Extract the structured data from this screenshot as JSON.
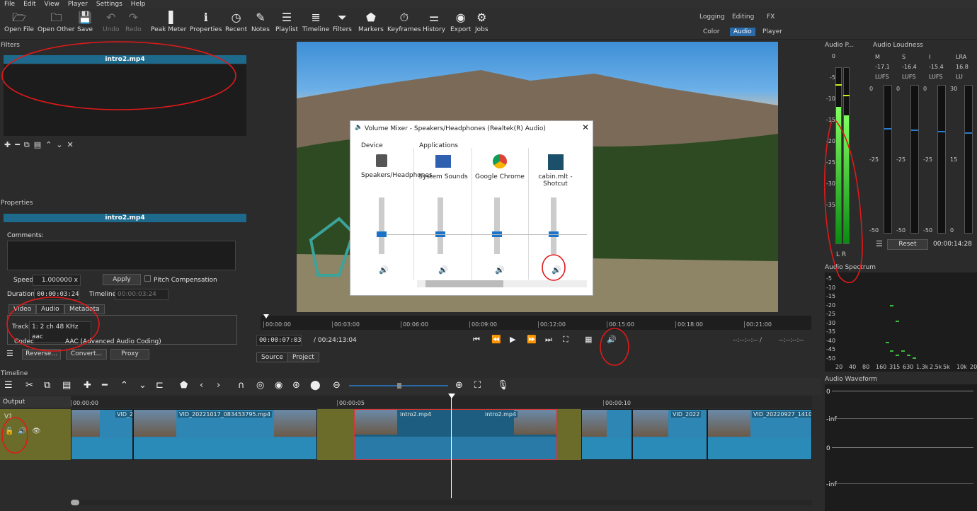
{
  "menu": [
    "File",
    "Edit",
    "View",
    "Player",
    "Settings",
    "Help"
  ],
  "toolbar": [
    {
      "label": "Open File",
      "icon": "folder-open-icon",
      "glyph": "🗁"
    },
    {
      "label": "Open Other",
      "icon": "open-other-icon",
      "glyph": "🗀"
    },
    {
      "label": "Save",
      "icon": "save-icon",
      "glyph": "💾"
    },
    {
      "label": "Undo",
      "icon": "undo-icon",
      "glyph": "↶"
    },
    {
      "label": "Redo",
      "icon": "redo-icon",
      "glyph": "↷"
    },
    {
      "label": "Peak Meter",
      "icon": "peak-meter-icon",
      "glyph": "▐"
    },
    {
      "label": "Properties",
      "icon": "info-icon",
      "glyph": "ℹ"
    },
    {
      "label": "Recent",
      "icon": "clock-icon",
      "glyph": "◷"
    },
    {
      "label": "Notes",
      "icon": "notes-icon",
      "glyph": "✎"
    },
    {
      "label": "Playlist",
      "icon": "playlist-icon",
      "glyph": "☰"
    },
    {
      "label": "Timeline",
      "icon": "timeline-icon",
      "glyph": "≣"
    },
    {
      "label": "Filters",
      "icon": "filter-icon",
      "glyph": "⏷"
    },
    {
      "label": "Markers",
      "icon": "marker-icon",
      "glyph": "⬟"
    },
    {
      "label": "Keyframes",
      "icon": "stopwatch-icon",
      "glyph": "⏱"
    },
    {
      "label": "History",
      "icon": "history-icon",
      "glyph": "⚌"
    },
    {
      "label": "Export",
      "icon": "export-icon",
      "glyph": "◉"
    },
    {
      "label": "Jobs",
      "icon": "gear-icon",
      "glyph": "⚙"
    }
  ],
  "layouts": {
    "logging": "Logging",
    "editing": "Editing",
    "fx": "FX",
    "color": "Color",
    "audio": "Audio",
    "player": "Player"
  },
  "filters": {
    "title": "Filters",
    "clip": "intro2.mp4"
  },
  "properties": {
    "title": "Properties",
    "clip": "intro2.mp4",
    "comments_label": "Comments:",
    "speed_label": "Speed",
    "speed_value": "1.000000 x",
    "apply": "Apply",
    "pitch": "Pitch Compensation",
    "duration_label": "Duration",
    "duration_value": "00:00:03:24",
    "timeline_label": "Timeline",
    "timeline_value": "00:00:03:24",
    "tabs": [
      "Video",
      "Audio",
      "Metadata"
    ],
    "track_label": "Track",
    "track_value": "1: 2 ch 48 KHz aac",
    "codec_label": "Codec",
    "codec_value": "AAC (Advanced Audio Coding)",
    "reverse": "Reverse...",
    "convert": "Convert...",
    "proxy": "Proxy"
  },
  "player": {
    "ruler": [
      "00:00:00",
      "00:03:00",
      "00:06:00",
      "00:09:00",
      "00:12:00",
      "00:15:00",
      "00:18:00",
      "00:21:00"
    ],
    "position": "00:00:07:03",
    "duration": "/ 00:24:13:04",
    "in": "--:--:--:-- /",
    "out": "--:--:--:--",
    "source": "Source",
    "project": "Project"
  },
  "mixer": {
    "title": "Volume Mixer - Speakers/Headphones (Realtek(R) Audio)",
    "device": "Device",
    "applications": "Applications",
    "items": [
      "Speakers/Headphones",
      "System Sounds",
      "Google Chrome",
      "cabin.mlt - Shotcut"
    ]
  },
  "audio_peak": {
    "title": "Audio P...",
    "scale": [
      "0",
      "-5",
      "-10",
      "-15",
      "-20",
      "-25",
      "-30",
      "-35"
    ],
    "lr": "L  R",
    "L": 0.78,
    "R": 0.73
  },
  "loudness": {
    "title": "Audio Loudness",
    "cols": [
      "M",
      "S",
      "I",
      "LRA"
    ],
    "vals": [
      "-17.1",
      "-16.4",
      "-15.4",
      "16.8"
    ],
    "units": [
      "LUFS",
      "LUFS",
      "LUFS",
      "LU"
    ],
    "top": [
      "0",
      "0",
      "0",
      "30"
    ],
    "mid": [
      "-25",
      "-25",
      "-25",
      "15"
    ],
    "bot": [
      "-50",
      "-50",
      "-50",
      "0"
    ],
    "reset": "Reset",
    "time": "00:00:14:28"
  },
  "spectrum": {
    "title": "Audio Spectrum",
    "scale": [
      "-5",
      "-10",
      "-15",
      "-20",
      "-25",
      "-30",
      "-35",
      "-40",
      "-45",
      "-50"
    ],
    "freqs": [
      "20",
      "40",
      "80",
      "160",
      "315",
      "630",
      "1.3k",
      "2.5k",
      "5k",
      "10k",
      "20k"
    ]
  },
  "waveform": {
    "title": "Audio Waveform",
    "labels": [
      "0",
      "-inf",
      "0",
      "-inf"
    ]
  },
  "timeline": {
    "title": "Timeline",
    "output": "Output",
    "track": "V1",
    "ruler": [
      "00:00:00",
      "00:00:05",
      "00:00:10"
    ],
    "clips": [
      "VID_20",
      "VID_20221017_083453795.mp4",
      "intro2.mp4",
      "intro2.mp4",
      "VID_2022",
      "VID_20220927_141037"
    ]
  }
}
